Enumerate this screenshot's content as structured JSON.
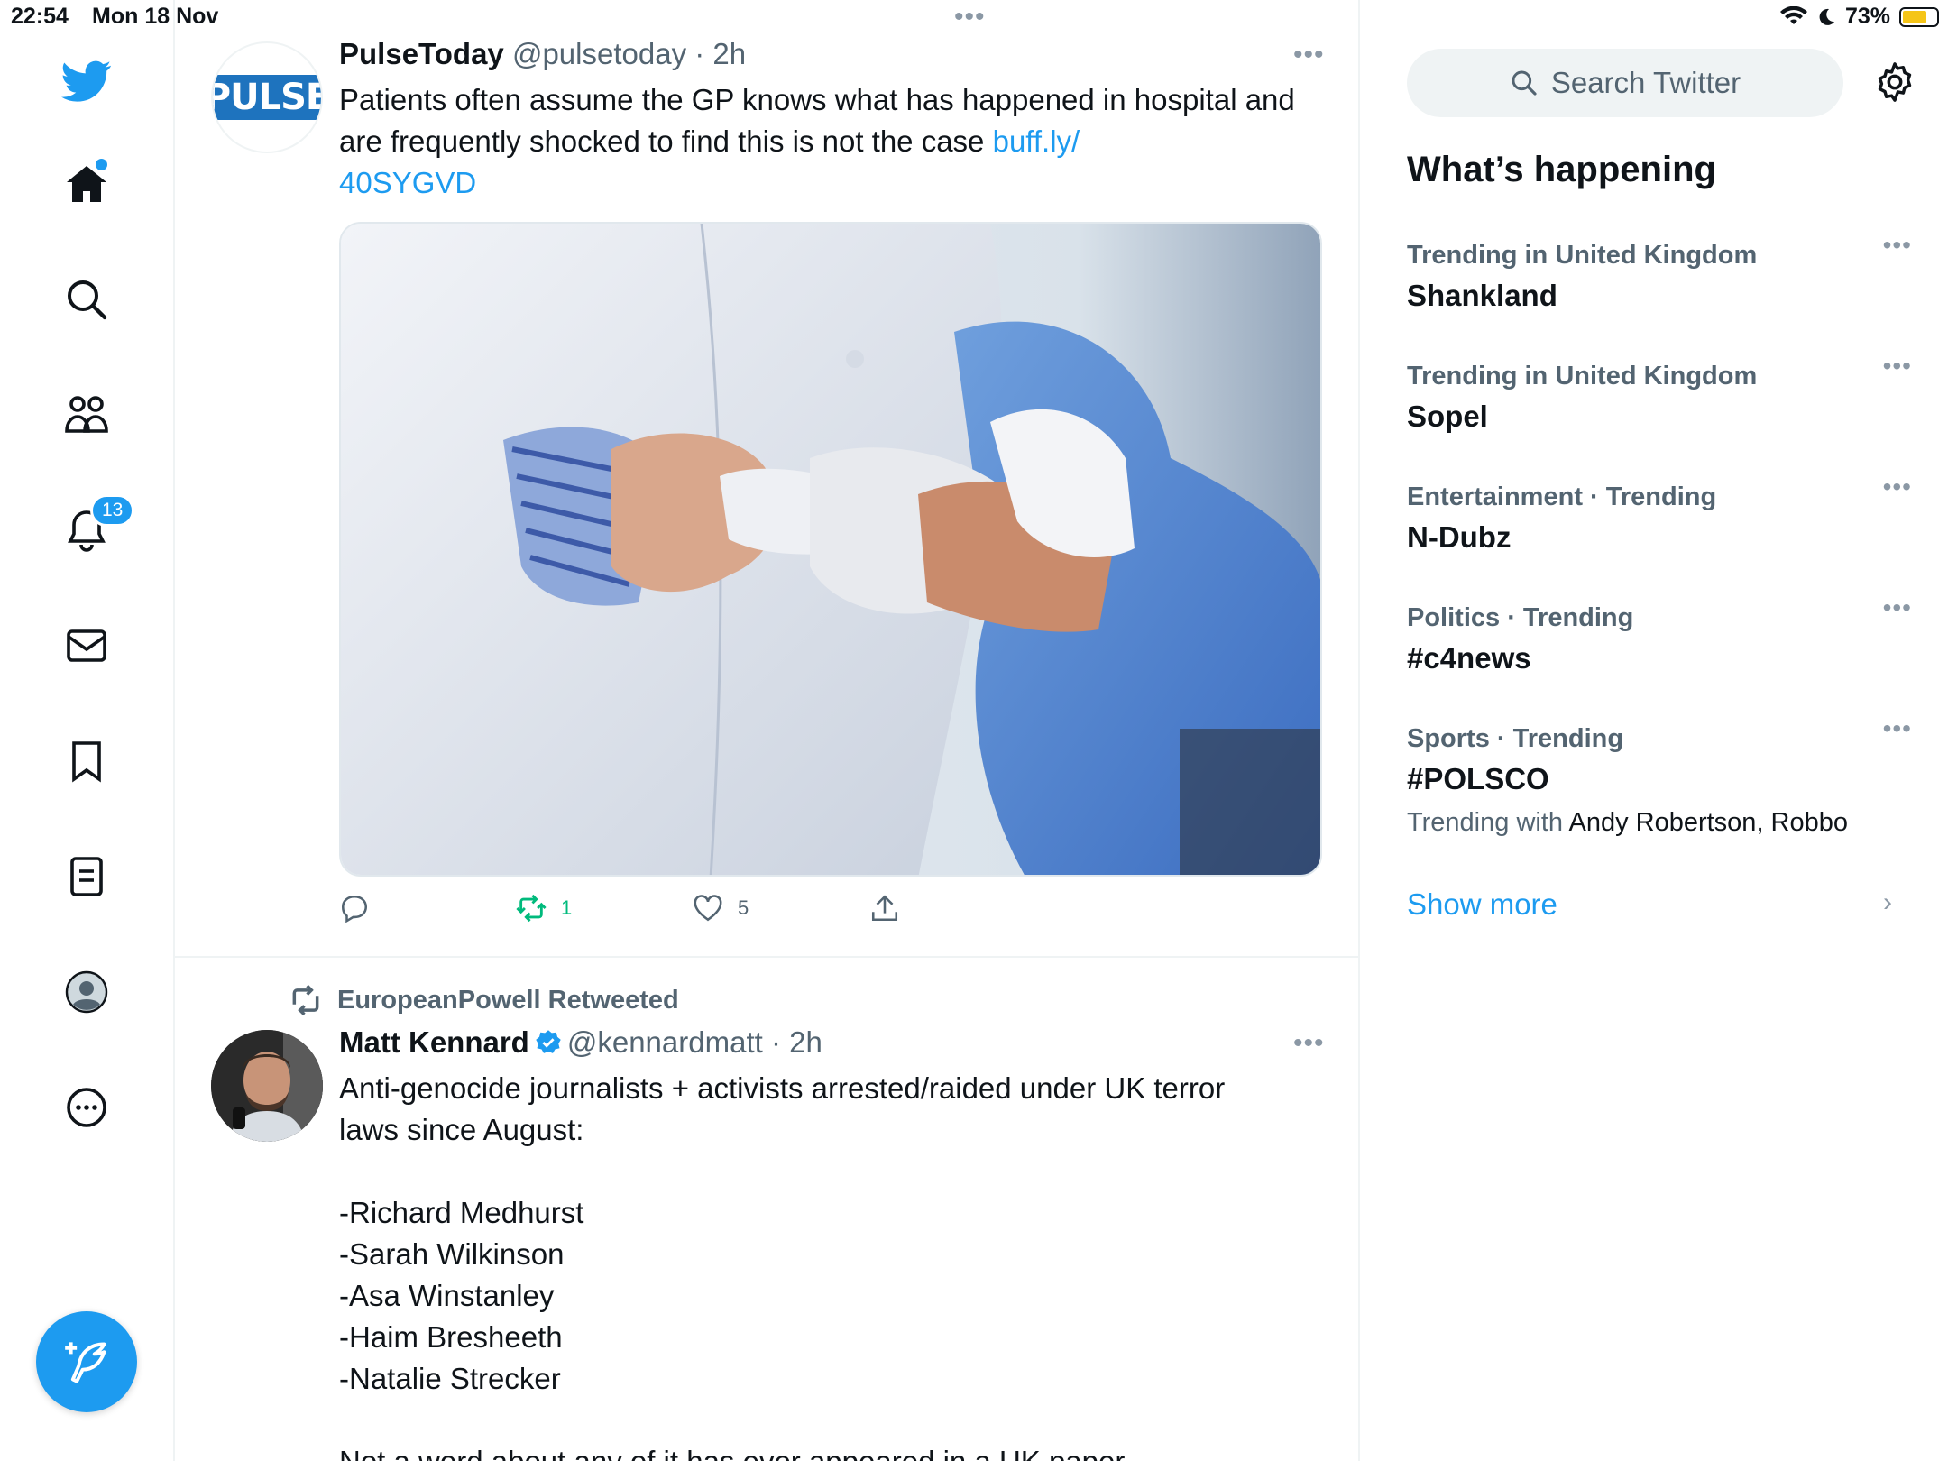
{
  "status_bar": {
    "time": "22:54",
    "date": "Mon 18 Nov",
    "battery": "73%",
    "battery_level": 0.73
  },
  "nav": {
    "items": [
      "home",
      "explore",
      "communities",
      "notifications",
      "messages",
      "bookmarks",
      "lists",
      "profile",
      "more"
    ],
    "notifications_badge": "13"
  },
  "feed": {
    "tweet1": {
      "name": "PulseToday",
      "handle": "@pulsetoday",
      "dot": "·",
      "time": "2h",
      "avatar_text": "PULSE",
      "text": "Patients often assume the GP knows what has happened in hospital and are frequently shocked to find this is not the case ",
      "link": "buff.ly/40SYGVD",
      "link_line1": "buff.ly/",
      "link_line2": "40SYGVD",
      "retweets": "1",
      "likes": "5"
    },
    "tweet2": {
      "retweeted_by": "EuropeanPowell Retweeted",
      "name": "Matt Kennard",
      "handle": "@kennardmatt",
      "dot": "·",
      "time": "2h",
      "text_line1": "Anti-genocide journalists + activists arrested/raided under UK terror",
      "text_line2": "laws since August:",
      "names": [
        "-Richard Medhurst",
        "-Sarah Wilkinson",
        "-Asa Winstanley",
        "-Haim Bresheeth",
        "-Natalie Strecker"
      ],
      "cut_line": "Not a word about any of it has ever appeared in a UK paper"
    }
  },
  "right": {
    "search_placeholder": "Search Twitter",
    "section_title": "What’s happening",
    "trends": [
      {
        "category": "Trending in United Kingdom",
        "name": "Shankland"
      },
      {
        "category": "Trending in United Kingdom",
        "name": "Sopel"
      },
      {
        "category": "Entertainment · Trending",
        "name": "N-Dubz"
      },
      {
        "category": "Politics · Trending",
        "name": "#c4news"
      },
      {
        "category": "Sports · Trending",
        "name": "#POLSCO",
        "with_label": "Trending with",
        "with_names": "Andy Robertson, Robbo"
      }
    ],
    "show_more": "Show more"
  },
  "colors": {
    "accent": "#1d9bf0",
    "retweet_green": "#00ba7c",
    "secondary_text": "#536471"
  }
}
